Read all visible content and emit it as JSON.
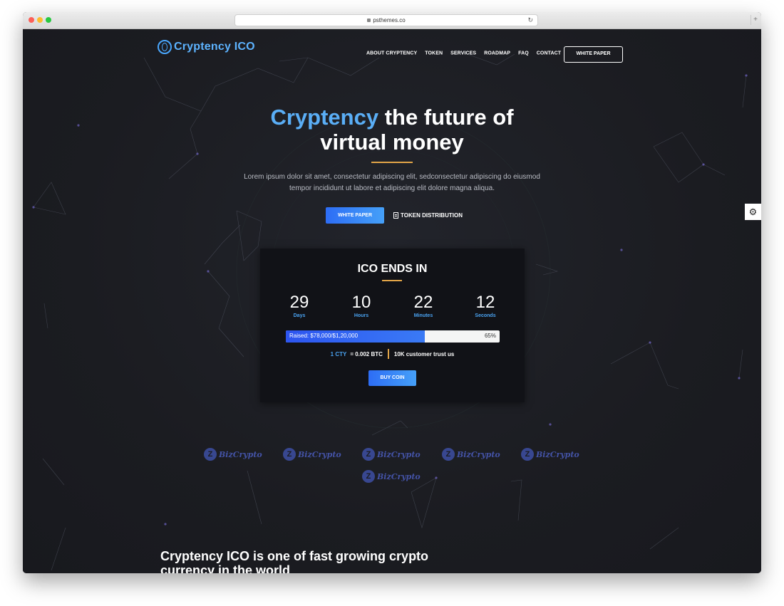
{
  "browser": {
    "url": "psthemes.co"
  },
  "header": {
    "logo_text": "Cryptency ICO",
    "nav": [
      "ABOUT CRYPTENCY",
      "TOKEN",
      "SERVICES",
      "ROADMAP",
      "FAQ",
      "CONTACT"
    ],
    "white_paper_button": "WHITE PAPER"
  },
  "hero": {
    "title_accent": "Cryptency",
    "title_rest_line1": " the future of",
    "title_line2": "virtual money",
    "description_line1": "Lorem ipsum dolor sit amet, consectetur adipiscing elit, sedconsectetur adipiscing do eiusmod",
    "description_line2": "tempor incididunt ut labore et adipiscing elit dolore magna aliqua.",
    "primary_button": "WHITE PAPER",
    "secondary_button": "TOKEN DISTRIBUTION"
  },
  "ico": {
    "title": "ICO ENDS IN",
    "countdown": [
      {
        "value": "29",
        "label": "Days"
      },
      {
        "value": "10",
        "label": "Hours"
      },
      {
        "value": "22",
        "label": "Minutes"
      },
      {
        "value": "12",
        "label": "Seconds"
      }
    ],
    "raised_text": "Raised: $78,000/$1,20,000",
    "progress_percent": 65,
    "progress_label": "65%",
    "rate_cty": "1 CTY",
    "rate_rest": "= 0.002 BTC",
    "trust_text": "10K customer trust us",
    "buy_button": "BUY COIN"
  },
  "partners": [
    "BizCrypto",
    "BizCrypto",
    "BizCrypto",
    "BizCrypto",
    "BizCrypto",
    "BizCrypto"
  ],
  "about": {
    "title_line1": "Cryptency ICO is one of fast growing crypto",
    "title_line2": "currency in the world"
  },
  "colors": {
    "accent_blue": "#5aaef6",
    "accent_gold": "#e2a548",
    "background": "#1c1d22",
    "button_gradient_start": "#2d6df5",
    "button_gradient_end": "#45a0f8"
  },
  "icons": {
    "settings": "gear-icon",
    "document": "document-icon",
    "lock": "lock-icon"
  }
}
